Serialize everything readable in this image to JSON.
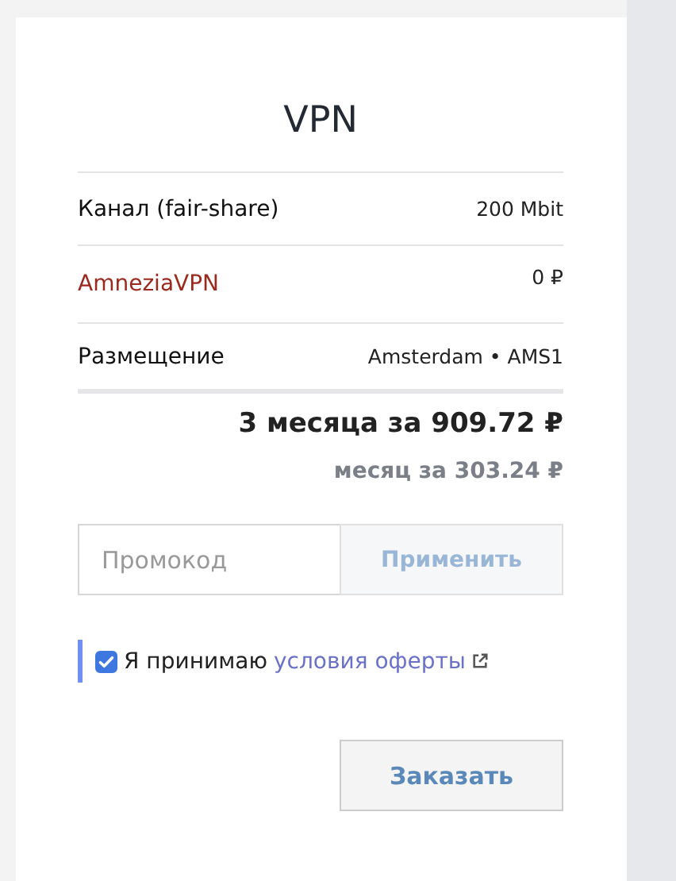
{
  "title": "VPN",
  "rows": [
    {
      "kind": "param",
      "label": "Канал (fair-share)",
      "value": "200 Mbit"
    },
    {
      "kind": "addon",
      "label": "AmneziaVPN",
      "value": "0 ₽"
    },
    {
      "kind": "param",
      "label": "Размещение",
      "value": "Amsterdam • AMS1"
    }
  ],
  "total": "3 месяца за 909.72 ₽",
  "monthly": "месяц за 303.24 ₽",
  "promo": {
    "placeholder": "Промокод",
    "button": "Применить"
  },
  "agreement": {
    "checked": true,
    "text": "Я принимаю",
    "link": "условия оферты"
  },
  "order_button": "Заказать"
}
